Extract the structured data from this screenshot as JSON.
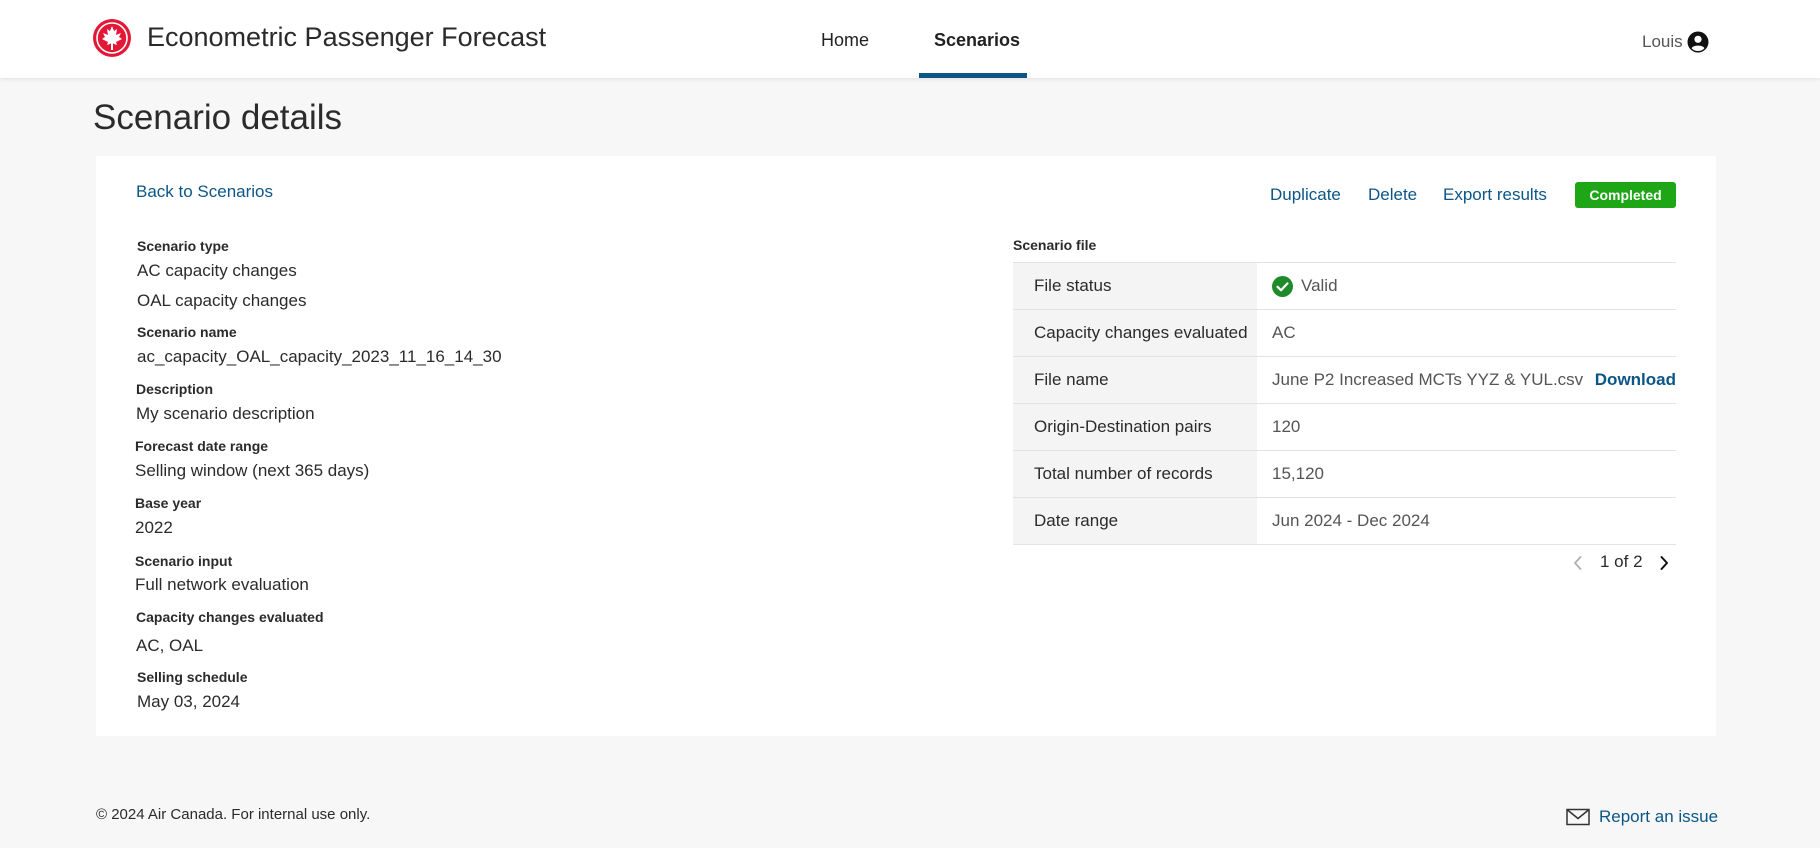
{
  "header": {
    "app_title": "Econometric Passenger Forecast",
    "nav": {
      "home": "Home",
      "scenarios": "Scenarios"
    },
    "user_name": "Louis",
    "brand_color": "#e31837",
    "accent_color": "#0b5687"
  },
  "page_title": "Scenario details",
  "back_link": "Back to Scenarios",
  "actions": {
    "duplicate": "Duplicate",
    "delete": "Delete",
    "export": "Export results",
    "status_badge": "Completed",
    "status_color": "#1ea617"
  },
  "details": {
    "scenario_type_label": "Scenario type",
    "scenario_type_values": [
      "AC capacity changes",
      "OAL capacity changes"
    ],
    "scenario_name_label": "Scenario name",
    "scenario_name": "ac_capacity_OAL_capacity_2023_11_16_14_30",
    "description_label": "Description",
    "description": "My scenario description",
    "forecast_label": "Forecast date range",
    "forecast": "Selling window (next 365 days)",
    "base_year_label": "Base year",
    "base_year": "2022",
    "input_label": "Scenario input",
    "input": "Full network evaluation",
    "capacity_label": "Capacity changes evaluated",
    "capacity": "AC, OAL",
    "schedule_label": "Selling schedule",
    "schedule": "May 03, 2024"
  },
  "file": {
    "heading": "Scenario file",
    "rows": [
      {
        "label": "File status",
        "value": "Valid"
      },
      {
        "label": "Capacity changes evaluated",
        "value": "AC"
      },
      {
        "label": "File name",
        "value": "June P2 Increased MCTs YYZ & YUL.csv"
      },
      {
        "label": "Origin-Destination pairs",
        "value": "120"
      },
      {
        "label": "Total number of records",
        "value": "15,120"
      },
      {
        "label": "Date range",
        "value": "Jun 2024 - Dec 2024"
      }
    ],
    "download": "Download",
    "pager": "1 of 2"
  },
  "footer": {
    "copyright": "© 2024 Air Canada. For internal use only.",
    "report": "Report an issue"
  }
}
